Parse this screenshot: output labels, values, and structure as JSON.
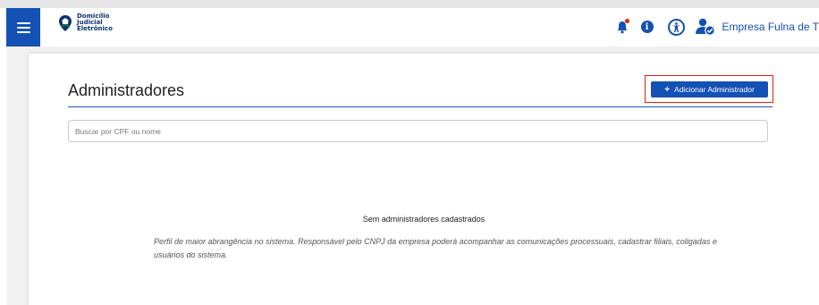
{
  "header": {
    "logo_lines": [
      "Domicílio",
      "Judicial",
      "Eletrônico"
    ],
    "company_name": "Empresa Fulna de T",
    "notification_dot_color": "#e52207",
    "icons": [
      "menu-icon",
      "bell-icon",
      "info-icon",
      "accessibility-icon",
      "user-check-icon"
    ]
  },
  "main": {
    "title": "Administradores",
    "add_button_label": "Adicionar Administrador",
    "add_button_icon": "+",
    "search_placeholder": "Buscar por CPF ou nome",
    "empty_title": "Sem administradores cadastrados",
    "empty_description": "Perfil de maior abrangência no sistema. Responsável pelo CNPJ da empresa poderá acompanhar as comunicações processuais, cadastrar filiais, coligadas e usuários do sistema."
  },
  "colors": {
    "primary": "#1451b4",
    "highlight_outline": "#e52207"
  }
}
